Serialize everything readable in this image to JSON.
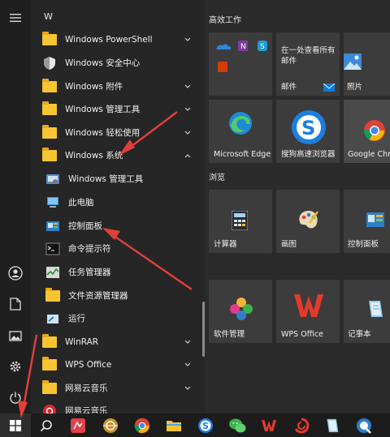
{
  "apps": {
    "letter": "W",
    "items": [
      {
        "label": "Windows PowerShell",
        "chevron": "down"
      },
      {
        "label": "Windows 安全中心"
      },
      {
        "label": "Windows 附件",
        "chevron": "down"
      },
      {
        "label": "Windows 管理工具",
        "chevron": "down"
      },
      {
        "label": "Windows 轻松使用",
        "chevron": "down"
      },
      {
        "label": "Windows 系统",
        "chevron": "up"
      },
      {
        "label": "Windows 管理工具"
      },
      {
        "label": "此电脑"
      },
      {
        "label": "控制面板"
      },
      {
        "label": "命令提示符"
      },
      {
        "label": "任务管理器"
      },
      {
        "label": "文件资源管理器"
      },
      {
        "label": "运行"
      },
      {
        "label": "WinRAR",
        "chevron": "down"
      },
      {
        "label": "WPS Office",
        "chevron": "down"
      },
      {
        "label": "网易云音乐",
        "chevron": "down"
      },
      {
        "label": "网易云音乐"
      }
    ]
  },
  "tiles": {
    "group1": "高效工作",
    "group2": "浏览",
    "mail_text": "在一处查看所有邮件",
    "mail": "邮件",
    "photos": "照片",
    "edge": "Microsoft Edge",
    "sogou": "搜狗高速浏览器",
    "chrome": "Google Chro",
    "calc": "计算器",
    "paint": "画图",
    "control": "控制面板",
    "software": "软件管理",
    "wps": "WPS Office",
    "notepad": "记事本"
  },
  "colors": {
    "arrow": "#e0403a",
    "folder": "#f7c533",
    "accent": "#0a7ad8"
  }
}
